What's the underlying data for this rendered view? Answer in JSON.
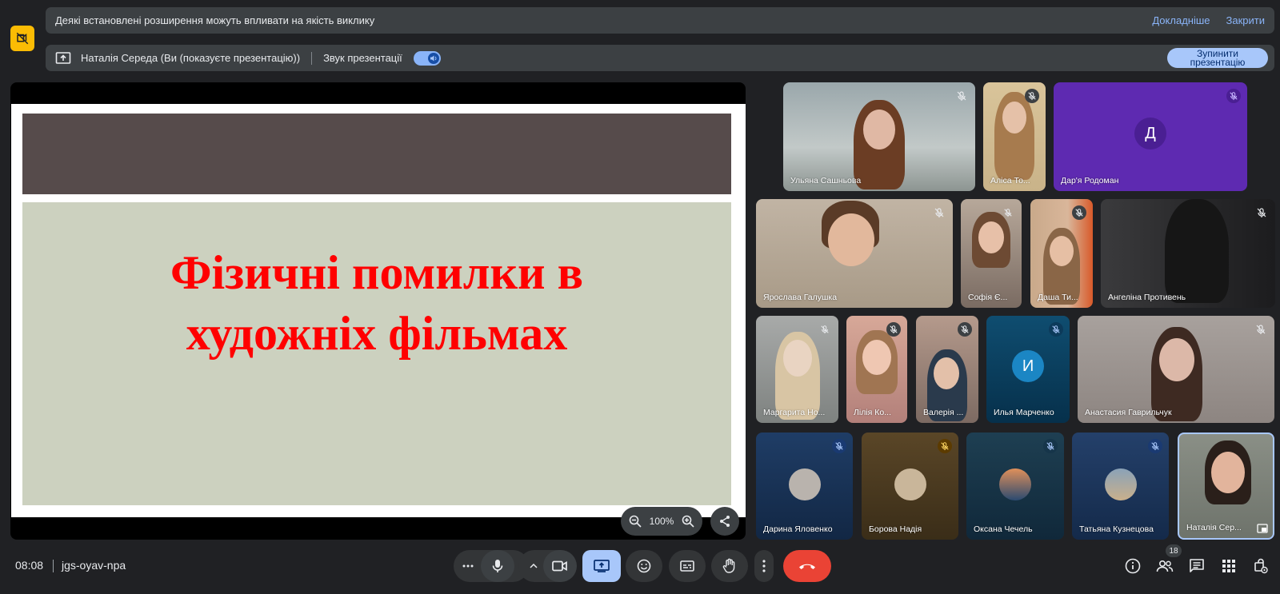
{
  "banners": {
    "extension_message": "Деякі встановлені розширення можуть впливати на якість виклику",
    "learn_more": "Докладніше",
    "close": "Закрити",
    "presenting_text": "Наталія Середа (Ви (показуєте презентацію))",
    "presentation_audio": "Звук презентації",
    "stop_presenting": "Зупинити презентацію"
  },
  "slide": {
    "title_line1": "Фізичні помилки в",
    "title_line2": "художніх фільмах",
    "zoom_level": "100%"
  },
  "participants": [
    {
      "name": "Ульяна Сашньова"
    },
    {
      "name": "Аліса То..."
    },
    {
      "name": "Дар'я Родоман",
      "initial": "Д"
    },
    {
      "name": "Ярослава Галушка"
    },
    {
      "name": "Софія Є..."
    },
    {
      "name": "Даша Ти..."
    },
    {
      "name": "Ангеліна Противень"
    },
    {
      "name": "Маргарита Но..."
    },
    {
      "name": "Лілія Ко..."
    },
    {
      "name": "Валерія ..."
    },
    {
      "name": "Илья Марченко",
      "initial": "И"
    },
    {
      "name": "Анастасия Гаврильчук"
    },
    {
      "name": "Дарина Яловенко"
    },
    {
      "name": "Борова Надія"
    },
    {
      "name": "Оксана Чечель"
    },
    {
      "name": "Татьяна Кузнецова"
    },
    {
      "name": "Наталія Сер..."
    }
  ],
  "bottom": {
    "time": "08:08",
    "meeting_code": "jgs-oyav-npa",
    "participant_count": "18"
  },
  "colors": {
    "accent": "#a8c7fa",
    "end_call": "#ea4335",
    "warning": "#fbbc04",
    "slide_title": "#ff0000"
  }
}
